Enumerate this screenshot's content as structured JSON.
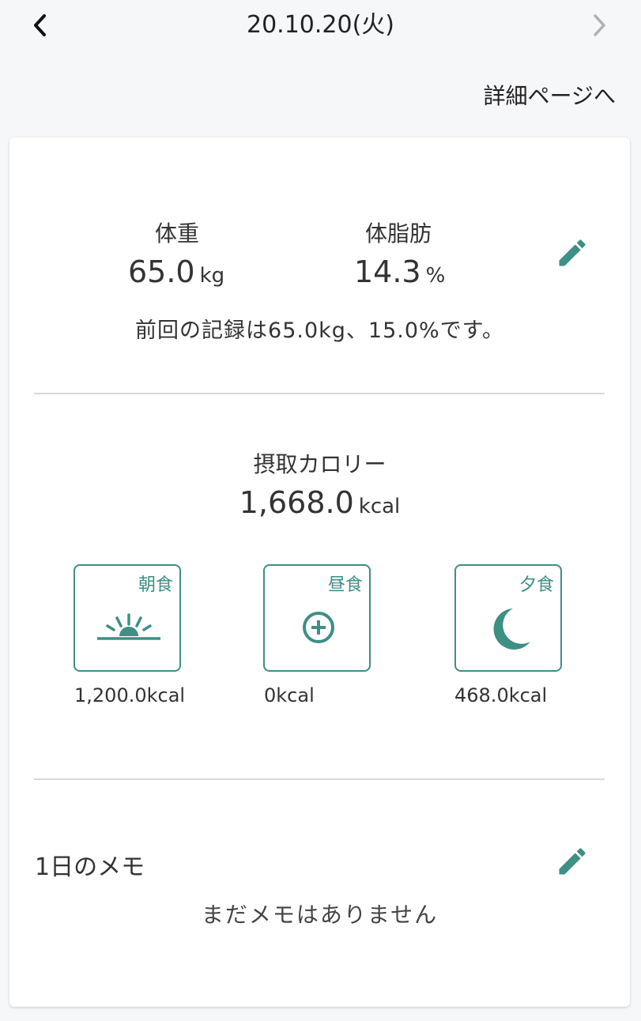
{
  "header": {
    "date": "20.10.20(火)",
    "back_icon": "chevron-left-icon",
    "forward_icon": "chevron-right-icon"
  },
  "detail_link": "詳細ページへ",
  "body_stats": {
    "weight_label": "体重",
    "weight_value": "65.0",
    "weight_unit": "kg",
    "fat_label": "体脂肪",
    "fat_value": "14.3",
    "fat_unit": "%",
    "previous_record": "前回の記録は65.0kg、15.0%です。",
    "edit_icon": "pencil-icon"
  },
  "calories": {
    "label": "摂取カロリー",
    "value": "1,668.0",
    "unit": "kcal"
  },
  "meals": [
    {
      "name": "朝食",
      "kcal": "1,200.0kcal",
      "icon": "sunrise-icon"
    },
    {
      "name": "昼食",
      "kcal": "0kcal",
      "icon": "add-circle-icon"
    },
    {
      "name": "夕食",
      "kcal": "468.0kcal",
      "icon": "moon-icon"
    }
  ],
  "memo": {
    "title": "1日のメモ",
    "empty_text": "まだメモはありません",
    "edit_icon": "pencil-icon"
  },
  "colors": {
    "accent": "#3e8f84",
    "background": "#f6f7f9",
    "card": "#ffffff",
    "divider": "#d8d8d8"
  }
}
